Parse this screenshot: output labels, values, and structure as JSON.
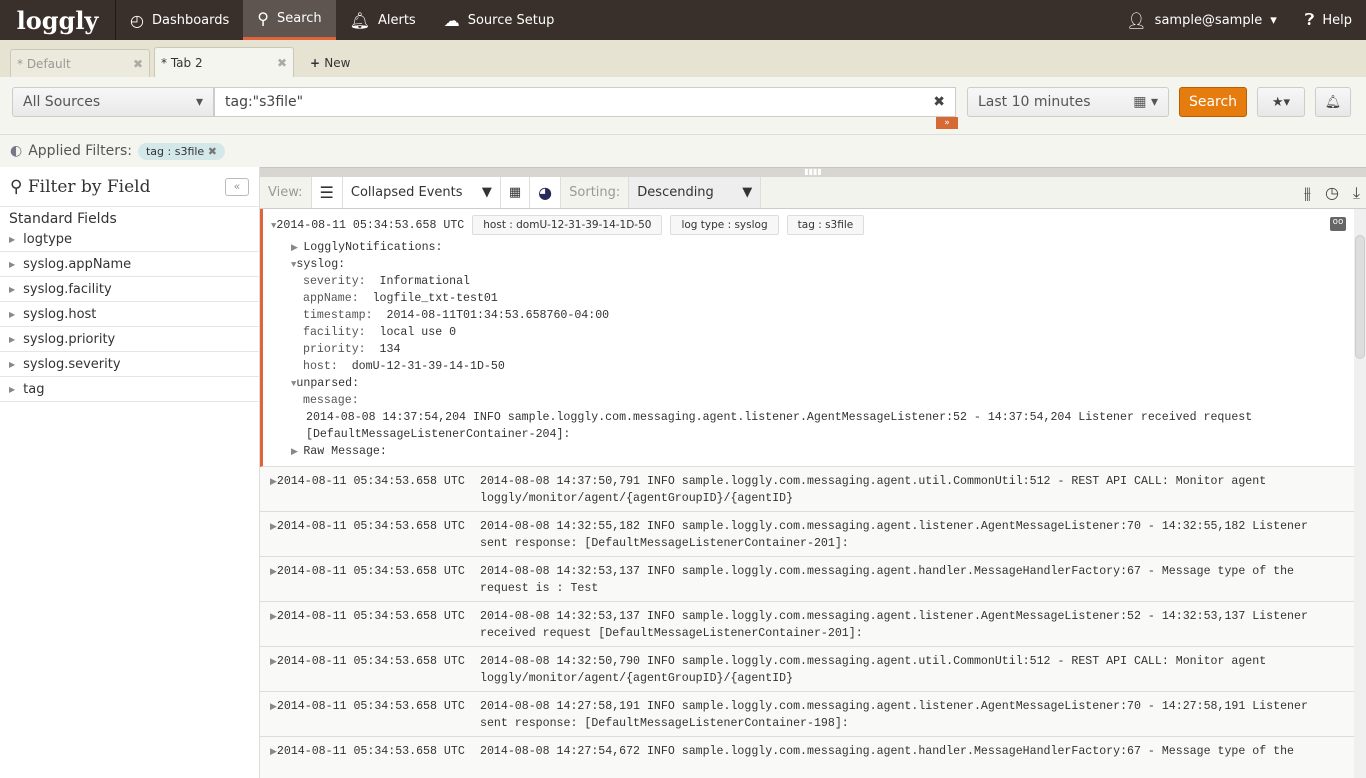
{
  "app": {
    "logo": "loggly",
    "nav": [
      {
        "label": "Dashboards",
        "icon": "gauge-icon"
      },
      {
        "label": "Search",
        "icon": "search-icon"
      },
      {
        "label": "Alerts",
        "icon": "bell-icon"
      },
      {
        "label": "Source Setup",
        "icon": "cloud-icon"
      }
    ],
    "user": "sample@sample",
    "help": "Help"
  },
  "tabs": [
    {
      "label": "* Default"
    },
    {
      "label": "* Tab 2"
    }
  ],
  "new_tab": "New",
  "search": {
    "source": "All Sources",
    "query": "tag:\"s3file\"",
    "time": "Last 10 minutes",
    "button": "Search"
  },
  "filters": {
    "label": "Applied Filters:",
    "chips": [
      "tag : s3file"
    ]
  },
  "sidebar": {
    "title": "Filter by Field",
    "section": "Standard Fields",
    "fields": [
      "logtype",
      "syslog.appName",
      "syslog.facility",
      "syslog.host",
      "syslog.priority",
      "syslog.severity",
      "tag"
    ]
  },
  "toolbar": {
    "view_label": "View:",
    "view": "Collapsed Events",
    "sort_label": "Sorting:",
    "sort": "Descending"
  },
  "expanded_event": {
    "timestamp": "2014-08-11 05:34:53.658 UTC",
    "badges": [
      "host : domU-12-31-39-14-1D-50",
      "log type : syslog",
      "tag : s3file"
    ],
    "notifications": "LogglyNotifications:",
    "syslog": "syslog:",
    "syslog_fields": [
      {
        "k": "severity:",
        "v": "Informational"
      },
      {
        "k": "appName:",
        "v": "logfile_txt-test01"
      },
      {
        "k": "timestamp:",
        "v": "2014-08-11T01:34:53.658760-04:00"
      },
      {
        "k": "facility:",
        "v": "local use 0"
      },
      {
        "k": "priority:",
        "v": "134"
      },
      {
        "k": "host:",
        "v": "domU-12-31-39-14-1D-50"
      }
    ],
    "unparsed": "unparsed:",
    "message_key": "message:",
    "message": [
      "2014-08-08 14:37:54,204 INFO sample.loggly.com.messaging.agent.listener.AgentMessageListener:52 - 14:37:54,204 Listener received request",
      "[DefaultMessageListenerContainer-204]:"
    ],
    "raw": "Raw Message:"
  },
  "events": [
    {
      "ts": "2014-08-11 05:34:53.658 UTC",
      "l1": "2014-08-08 14:37:50,791 INFO sample.loggly.com.messaging.agent.util.CommonUtil:512 - REST API CALL: Monitor agent",
      "l2": "loggly/monitor/agent/{agentGroupID}/{agentID}"
    },
    {
      "ts": "2014-08-11 05:34:53.658 UTC",
      "l1": "2014-08-08 14:32:55,182 INFO sample.loggly.com.messaging.agent.listener.AgentMessageListener:70 - 14:32:55,182 Listener",
      "l2": "sent response: [DefaultMessageListenerContainer-201]:"
    },
    {
      "ts": "2014-08-11 05:34:53.658 UTC",
      "l1": "2014-08-08 14:32:53,137 INFO sample.loggly.com.messaging.agent.handler.MessageHandlerFactory:67 - Message type of the",
      "l2": "request is : Test"
    },
    {
      "ts": "2014-08-11 05:34:53.658 UTC",
      "l1": "2014-08-08 14:32:53,137 INFO sample.loggly.com.messaging.agent.listener.AgentMessageListener:52 - 14:32:53,137 Listener",
      "l2": "received request [DefaultMessageListenerContainer-201]:"
    },
    {
      "ts": "2014-08-11 05:34:53.658 UTC",
      "l1": "2014-08-08 14:32:50,790 INFO sample.loggly.com.messaging.agent.util.CommonUtil:512 - REST API CALL: Monitor agent",
      "l2": "loggly/monitor/agent/{agentGroupID}/{agentID}"
    },
    {
      "ts": "2014-08-11 05:34:53.658 UTC",
      "l1": "2014-08-08 14:27:58,191 INFO sample.loggly.com.messaging.agent.listener.AgentMessageListener:70 - 14:27:58,191 Listener",
      "l2": "sent response: [DefaultMessageListenerContainer-198]:"
    },
    {
      "ts": "2014-08-11 05:34:53.658 UTC",
      "l1": "2014-08-08 14:27:54,672 INFO sample.loggly.com.messaging.agent.handler.MessageHandlerFactory:67 - Message type of the",
      "l2": ""
    }
  ]
}
